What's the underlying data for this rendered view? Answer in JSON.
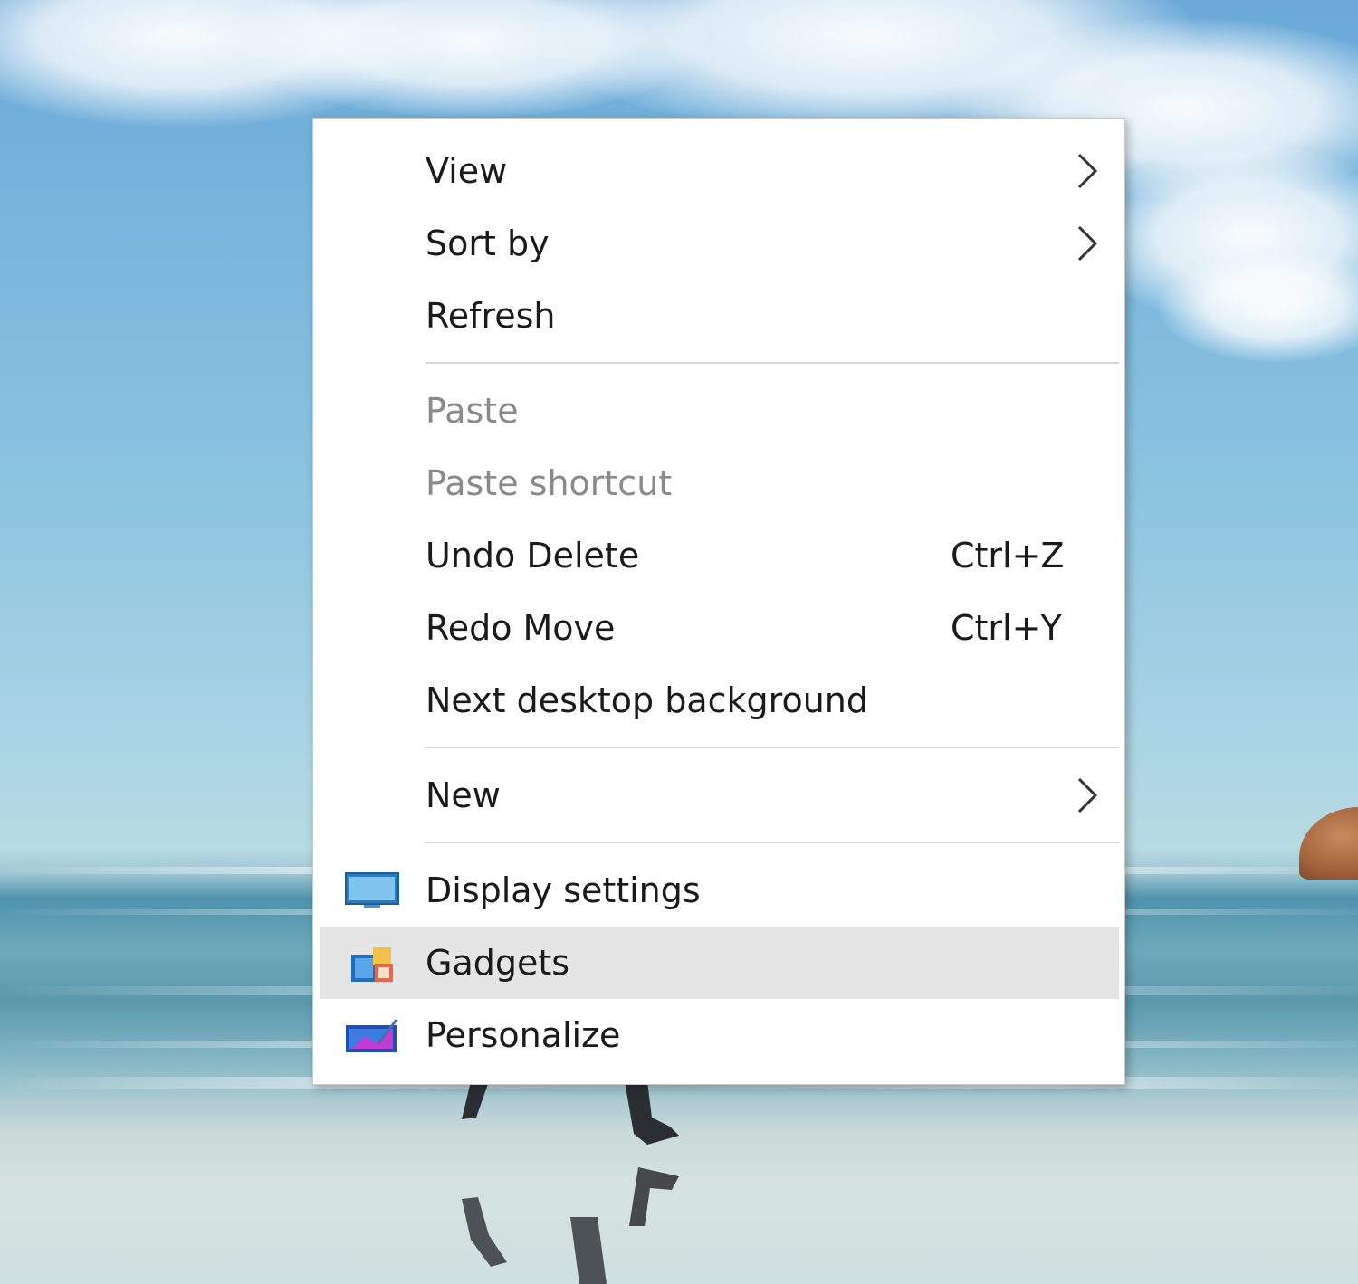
{
  "desktop": {
    "wallpaper": "beach-runner-wallpaper"
  },
  "context_menu": {
    "items": [
      {
        "label": "View",
        "has_submenu": true,
        "icon": "chevron-right-icon"
      },
      {
        "label": "Sort by",
        "has_submenu": true,
        "icon": "chevron-right-icon"
      },
      {
        "label": "Refresh"
      },
      {
        "label": "Paste",
        "disabled": true
      },
      {
        "label": "Paste shortcut",
        "disabled": true
      },
      {
        "label": "Undo Delete",
        "shortcut": "Ctrl+Z"
      },
      {
        "label": "Redo Move",
        "shortcut": "Ctrl+Y"
      },
      {
        "label": "Next desktop background"
      },
      {
        "label": "New",
        "has_submenu": true,
        "icon": "chevron-right-icon"
      },
      {
        "label": "Display settings",
        "icon": "display-settings-icon"
      },
      {
        "label": "Gadgets",
        "icon": "gadgets-icon",
        "highlighted": true
      },
      {
        "label": "Personalize",
        "icon": "personalize-icon"
      }
    ]
  },
  "colors": {
    "menu_background": "#ffffff",
    "menu_text": "#1a1a1a",
    "disabled_text": "#8a8a8a",
    "hover_background": "#e5e5e5",
    "separator": "#d6d6d6"
  }
}
